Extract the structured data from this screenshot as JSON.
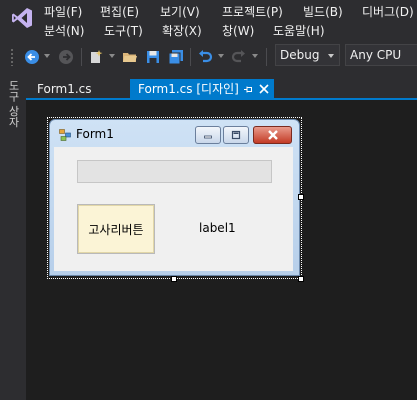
{
  "menubar": {
    "row1": [
      "파일(F)",
      "편집(E)",
      "보기(V)",
      "프로젝트(P)",
      "빌드(B)",
      "디버그(D)"
    ],
    "row2": [
      "분석(N)",
      "도구(T)",
      "확장(X)",
      "창(W)",
      "도움말(H)"
    ]
  },
  "toolbar": {
    "configuration": "Debug",
    "platform": "Any CPU",
    "icons": [
      "back-icon",
      "forward-icon",
      "new-project-icon",
      "open-folder-icon",
      "save-icon",
      "save-all-icon",
      "undo-icon",
      "redo-icon"
    ]
  },
  "left_strip": {
    "toolbox_label": "도구 상자"
  },
  "tabs": [
    {
      "label": "Form1.cs",
      "active": false
    },
    {
      "label": "Form1.cs [디자인]",
      "active": true
    }
  ],
  "form": {
    "title": "Form1",
    "button_label": "고사리버튼",
    "label_text": "label1"
  },
  "colors": {
    "accent": "#007acc",
    "background": "#1e1e1e",
    "chrome": "#2d2d30",
    "text": "#f1f1f1"
  }
}
